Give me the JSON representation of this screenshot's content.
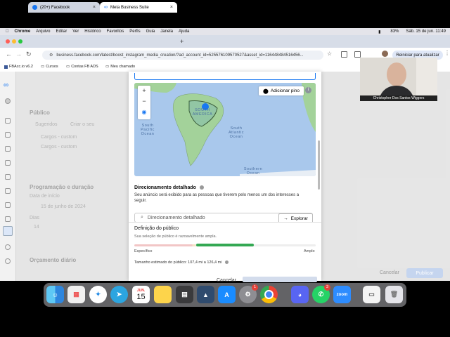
{
  "menubar": {
    "app": "Chrome",
    "items": [
      "Arquivo",
      "Editar",
      "Ver",
      "Histórico",
      "Favoritos",
      "Perfis",
      "Guia",
      "Janela",
      "Ajuda"
    ],
    "battery": "83%",
    "datetime": "Sáb. 15 de jun.  11:49"
  },
  "browser": {
    "tabs": [
      {
        "label": "(20+) Facebook"
      },
      {
        "label": "Meta Business Suite"
      }
    ],
    "url": "business.facebook.com/latest/boost_instagram_media_creation/?ad_account_id=525576109570527&asset_id=116448484516456...",
    "restart_label": "Reiniciar para atualizar",
    "bookmarks": [
      {
        "label": "FBAcc.io v6.2"
      },
      {
        "label": "Cursos"
      },
      {
        "label": "Contas FB ADS"
      },
      {
        "label": "Meu chamado"
      }
    ]
  },
  "background": {
    "publico_title": "Público",
    "sugeridos": "Sugeridos",
    "criar_novo": "Criar o seu",
    "cargos_custom": "Cargos - custom",
    "cargos": "Cargos - custom",
    "programacao_title": "Programação e duração",
    "data_inicio_label": "Data de início",
    "data_inicio": "15 de junho de 2024",
    "dias_label": "Dias",
    "dias": "14",
    "orcamento_title": "Orçamento diário",
    "cancel": "Cancelar",
    "publish": "Publicar"
  },
  "map": {
    "add_pin": "Adicionar pino",
    "zoom_in": "+",
    "zoom_out": "−",
    "labels": {
      "south_america": "SOUTH AMERICA",
      "south_pacific": "South Pacific Ocean",
      "south_atlantic": "South Atlantic Ocean",
      "southern": "Southern Ocean"
    }
  },
  "targeting": {
    "title": "Direcionamento detalhado",
    "description": "Seu anúncio será exibido para as pessoas que tiverem pelo menos um dos interesses a seguir.",
    "search_placeholder": "Direcionamento detalhado",
    "explore": "Explorar"
  },
  "definition": {
    "title": "Definição do público",
    "description": "Sua seleção de público é razoavelmente ampla.",
    "specific": "Específico",
    "broad": "Amplo",
    "size": "Tamanho estimado do público: 107,4 mi a 126,4 mi"
  },
  "modal_footer": {
    "cancel": "Cancelar"
  },
  "webcam": {
    "name": "Christopher Dos Santos Wiggers"
  },
  "dock": {
    "calendar_month": "JUN.",
    "calendar_day": "15",
    "badges": {
      "settings": "1",
      "whatsapp": "3"
    },
    "zoom": "zoom"
  },
  "colors": {
    "accent": "#1877f2",
    "audience_green": "#34a853",
    "map_water": "#a9c8ec",
    "map_land": "#9dd3a2"
  }
}
